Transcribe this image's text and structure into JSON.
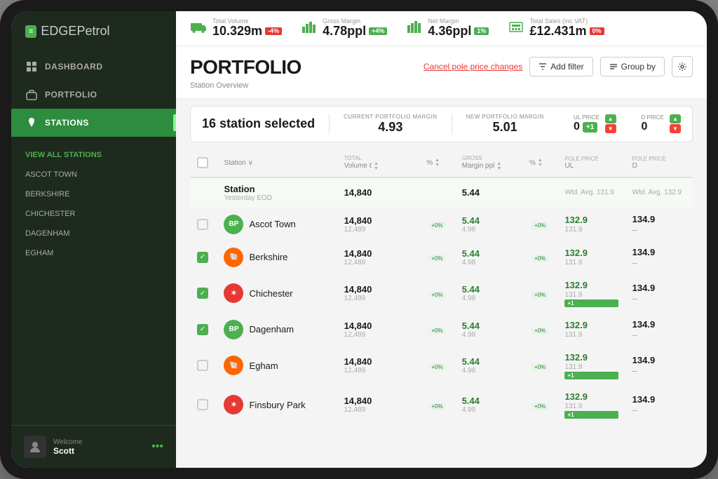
{
  "app": {
    "logo_prefix": "EDGE",
    "logo_suffix": "Petrol"
  },
  "top_bar": {
    "metrics": [
      {
        "id": "total-volume",
        "label": "Total Volume",
        "value": "10.329m",
        "badge": "-4%",
        "badge_type": "red",
        "icon": "truck-icon"
      },
      {
        "id": "gross-margin",
        "label": "Gross Margin",
        "value": "4.78ppl",
        "badge": "+4%",
        "badge_type": "green",
        "icon": "bar-chart-icon"
      },
      {
        "id": "net-margin",
        "label": "Net Margin",
        "value": "4.36ppl",
        "badge": "1%",
        "badge_type": "green",
        "icon": "bar-chart-icon"
      },
      {
        "id": "total-sales",
        "label": "Total Sales (inc VAT)",
        "value": "£12.431m",
        "badge": "0%",
        "badge_type": "red",
        "icon": "register-icon"
      }
    ]
  },
  "sidebar": {
    "nav_items": [
      {
        "id": "dashboard",
        "label": "DASHBOARD",
        "icon": "grid-icon"
      },
      {
        "id": "portfolio",
        "label": "PORTFOLIO",
        "icon": "briefcase-icon"
      },
      {
        "id": "stations",
        "label": "STATIONS",
        "icon": "map-pin-icon",
        "active": true
      }
    ],
    "sub_nav": [
      {
        "id": "view-all",
        "label": "VIEW ALL STATIONS",
        "highlighted": true
      },
      {
        "id": "ascot-town",
        "label": "ASCOT TOWN"
      },
      {
        "id": "berkshire",
        "label": "BERKSHIRE"
      },
      {
        "id": "chichester",
        "label": "CHICHESTER"
      },
      {
        "id": "dagenham",
        "label": "DAGENHAM"
      },
      {
        "id": "egham",
        "label": "EGHAM"
      }
    ],
    "footer": {
      "welcome_label": "Welcome",
      "user_name": "Scott"
    }
  },
  "page": {
    "title": "PORTFOLIO",
    "subtitle": "Station Overview",
    "cancel_link": "Cancel pole price changes",
    "add_filter_label": "Add filter",
    "group_by_label": "Group by"
  },
  "selection_bar": {
    "label": "16 station selected",
    "current_margin_label": "CURRENT PORTFOLIO MARGIN",
    "current_margin_value": "4.93",
    "new_margin_label": "NEW PORTFOLIO MARGIN",
    "new_margin_value": "5.01",
    "ul_price_label": "UL PRICE",
    "ul_price_value": "+1",
    "ul_price_num": "0",
    "d_price_label": "D PRICE",
    "d_price_value": "0"
  },
  "table": {
    "headers": [
      {
        "id": "select",
        "label": ""
      },
      {
        "id": "station",
        "label": "Station"
      },
      {
        "id": "volume",
        "label": "Volume ℓ",
        "sub_label": "TOTAL"
      },
      {
        "id": "vol_pct",
        "label": "%"
      },
      {
        "id": "margin",
        "label": "Margin ppl",
        "sub_label": "GROSS"
      },
      {
        "id": "margin_pct",
        "label": "%"
      },
      {
        "id": "ul_price",
        "label": "UL",
        "sub_label": "POLE PRICE"
      },
      {
        "id": "d_price",
        "label": "D",
        "sub_label": "POLE PRICE"
      }
    ],
    "summary_row": {
      "name": "Station",
      "sub": "Yesterday EOD",
      "volume": "14,840",
      "margin": "5.44",
      "ul": "Wtd. Avg. 131.9",
      "d": "Wtd. Avg. 132.9"
    },
    "rows": [
      {
        "id": "ascot-town",
        "name": "Ascot Town",
        "brand": "bp",
        "checked": false,
        "volume": "14,840",
        "volume_sub": "12,489",
        "margin": "5.44",
        "margin_sub": "4.98",
        "ul_main": "132.9",
        "ul_sub": "131.9",
        "ul_badge": "",
        "d_main": "134.9",
        "d_dash": "–"
      },
      {
        "id": "berkshire",
        "name": "Berkshire",
        "brand": "shell",
        "checked": true,
        "volume": "14,840",
        "volume_sub": "12,489",
        "margin": "5.44",
        "margin_sub": "4.98",
        "ul_main": "132.9",
        "ul_sub": "131.9",
        "ul_badge": "",
        "d_main": "134.9",
        "d_dash": "–"
      },
      {
        "id": "chichester",
        "name": "Chichester",
        "brand": "texaco",
        "checked": true,
        "volume": "14,840",
        "volume_sub": "12,489",
        "margin": "5.44",
        "margin_sub": "4.98",
        "ul_main": "132.9",
        "ul_sub": "131.9",
        "ul_badge": "+1",
        "d_main": "134.9",
        "d_dash": "–"
      },
      {
        "id": "dagenham",
        "name": "Dagenham",
        "brand": "bp",
        "checked": true,
        "volume": "14,840",
        "volume_sub": "12,489",
        "margin": "5.44",
        "margin_sub": "4.98",
        "ul_main": "132.9",
        "ul_sub": "131.9",
        "ul_badge": "",
        "d_main": "134.9",
        "d_dash": "–"
      },
      {
        "id": "egham",
        "name": "Egham",
        "brand": "shell",
        "checked": false,
        "volume": "14,840",
        "volume_sub": "12,489",
        "margin": "5.44",
        "margin_sub": "4.98",
        "ul_main": "132.9",
        "ul_sub": "131.9",
        "ul_badge": "+1",
        "d_main": "134.9",
        "d_dash": "–"
      },
      {
        "id": "finsbury-park",
        "name": "Finsbury Park",
        "brand": "texaco",
        "checked": false,
        "volume": "14,840",
        "volume_sub": "12,489",
        "margin": "5.44",
        "margin_sub": "4.98",
        "ul_main": "132.9",
        "ul_sub": "131.9",
        "ul_badge": "+1",
        "d_main": "134.9",
        "d_dash": "–"
      }
    ]
  }
}
